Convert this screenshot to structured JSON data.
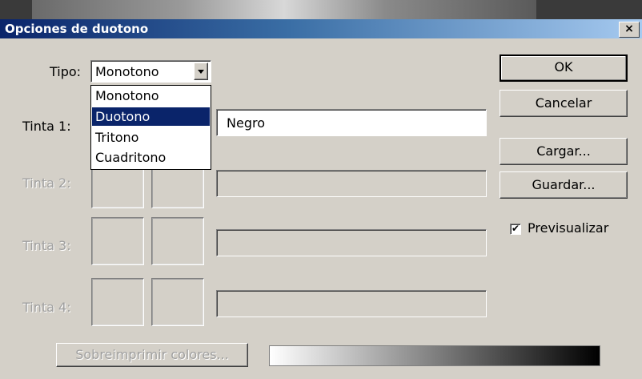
{
  "dialog": {
    "title": "Opciones de duotono",
    "close_glyph": "×"
  },
  "tipo": {
    "label": "Tipo:",
    "selected": "Monotono",
    "options": [
      "Monotono",
      "Duotono",
      "Tritono",
      "Cuadritono"
    ],
    "highlighted": "Duotono"
  },
  "inks": [
    {
      "label": "Tinta 1:",
      "name": "Negro",
      "enabled": true
    },
    {
      "label": "Tinta 2:",
      "name": "",
      "enabled": false
    },
    {
      "label": "Tinta 3:",
      "name": "",
      "enabled": false
    },
    {
      "label": "Tinta 4:",
      "name": "",
      "enabled": false
    }
  ],
  "buttons": {
    "ok": "OK",
    "cancel": "Cancelar",
    "load": "Cargar...",
    "save": "Guardar...",
    "overprint": "Sobreimprimir colores..."
  },
  "preview": {
    "label": "Previsualizar",
    "checked": true,
    "check_glyph": "✔"
  },
  "icons": {
    "dropdown_arrow": "dropdown-arrow-icon",
    "close": "close-icon",
    "check": "check-icon"
  },
  "colors": {
    "dialog_bg": "#d4d0c8",
    "title_start": "#0a246a",
    "title_end": "#a6caf0",
    "selection": "#0a246a"
  }
}
